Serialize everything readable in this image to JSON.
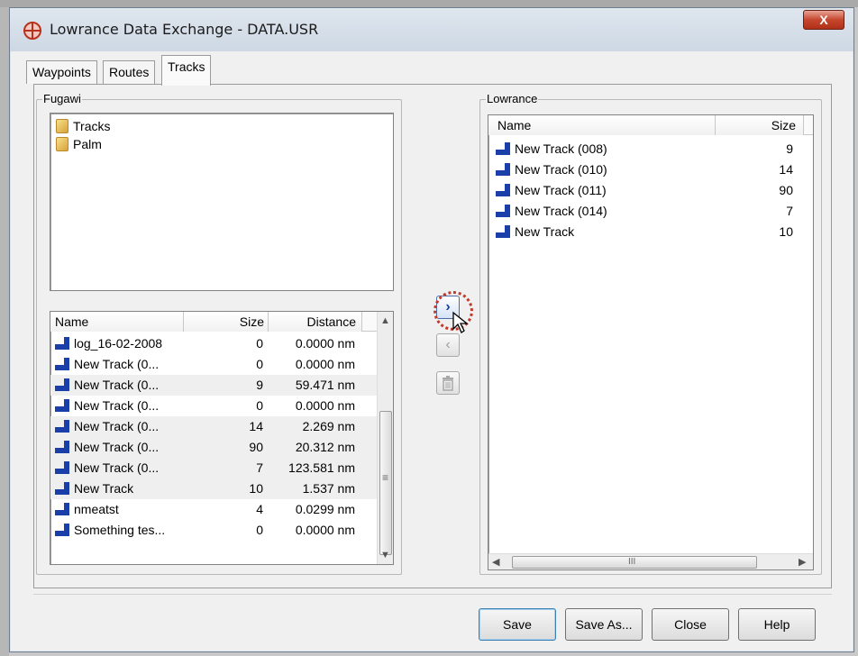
{
  "window": {
    "title": "Lowrance Data Exchange - DATA.USR",
    "close_glyph": "X"
  },
  "tabs": [
    {
      "label": "Waypoints"
    },
    {
      "label": "Routes"
    },
    {
      "label": "Tracks",
      "active": true
    }
  ],
  "fugawi": {
    "group_label": "Fugawi",
    "folders": [
      {
        "label": "Tracks",
        "icon": "folder-icon"
      },
      {
        "label": "Palm",
        "icon": "folder-icon"
      }
    ],
    "columns": [
      "Name",
      "Size",
      "Distance"
    ],
    "rows": [
      {
        "name": "log_16-02-2008",
        "size": "0",
        "distance": "0.0000 nm"
      },
      {
        "name": "New Track (0...",
        "size": "0",
        "distance": "0.0000 nm"
      },
      {
        "name": "New Track (0...",
        "size": "9",
        "distance": "59.471 nm"
      },
      {
        "name": "New Track (0...",
        "size": "0",
        "distance": "0.0000 nm"
      },
      {
        "name": "New Track (0...",
        "size": "14",
        "distance": "2.269 nm"
      },
      {
        "name": "New Track (0...",
        "size": "90",
        "distance": "20.312 nm"
      },
      {
        "name": "New Track (0...",
        "size": "7",
        "distance": "123.581 nm"
      },
      {
        "name": "New Track",
        "size": "10",
        "distance": "1.537 nm"
      },
      {
        "name": "nmeatst",
        "size": "4",
        "distance": "0.0299 nm"
      },
      {
        "name": "Something tes...",
        "size": "0",
        "distance": "0.0000 nm"
      }
    ]
  },
  "transfer": {
    "to_right_glyph": "›",
    "to_left_glyph": "‹",
    "delete_icon": "trash-icon"
  },
  "lowrance": {
    "group_label": "Lowrance",
    "columns": [
      "Name",
      "Size"
    ],
    "rows": [
      {
        "name": "New Track (008)",
        "size": "9"
      },
      {
        "name": "New Track (010)",
        "size": "14"
      },
      {
        "name": "New Track (011)",
        "size": "90"
      },
      {
        "name": "New Track (014)",
        "size": "7"
      },
      {
        "name": "New Track",
        "size": "10"
      }
    ],
    "hscroll_grip": "III"
  },
  "buttons": {
    "save": "Save",
    "save_as": "Save As...",
    "close": "Close",
    "help": "Help"
  },
  "colors": {
    "track_icon": "#1a3fa8",
    "close_button": "#c5462d"
  }
}
